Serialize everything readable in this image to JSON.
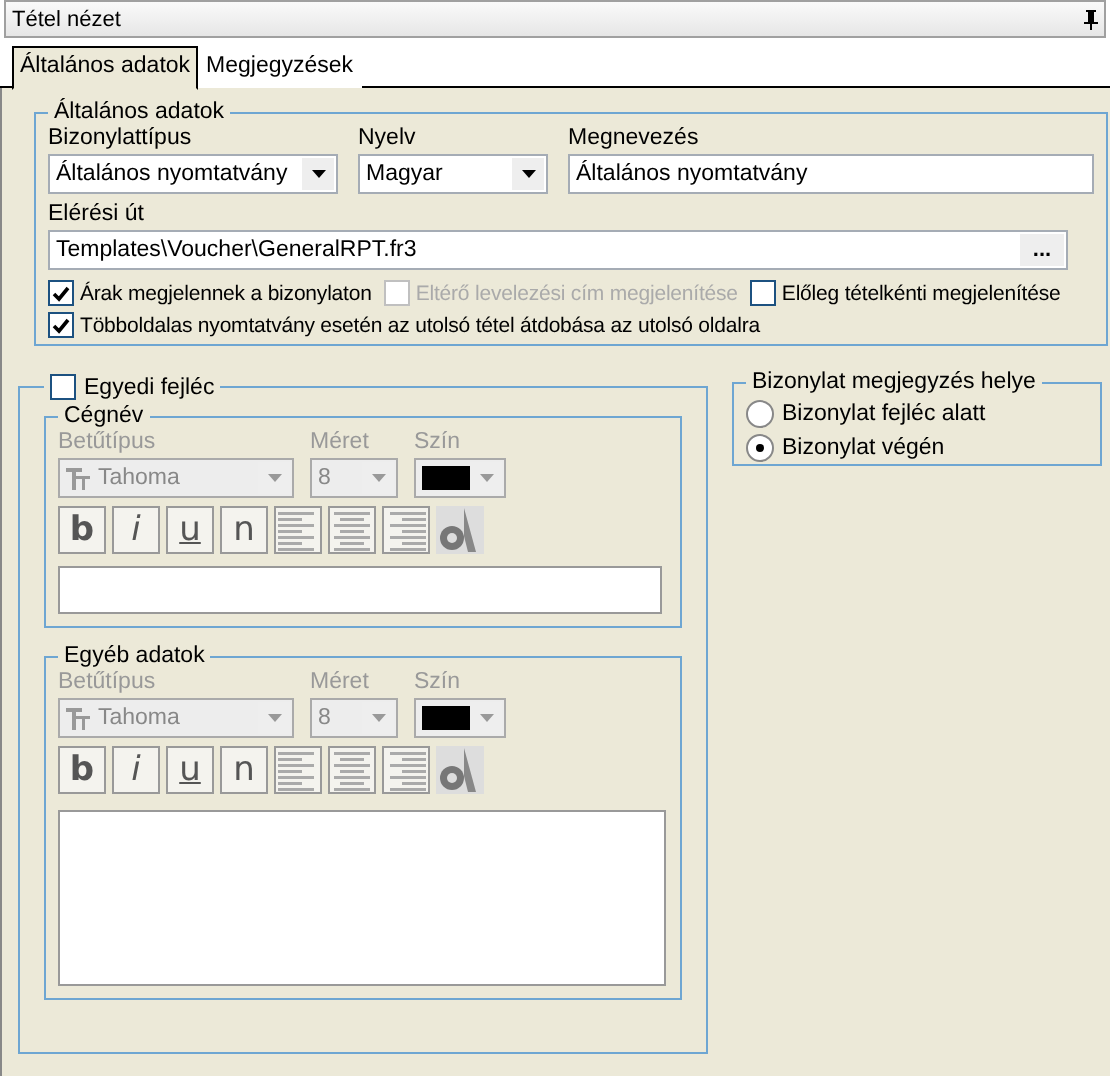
{
  "panel": {
    "title": "Tétel nézet"
  },
  "tabs": [
    {
      "label": "Általános adatok",
      "selected": true
    },
    {
      "label": "Megjegyzések",
      "selected": false
    }
  ],
  "general": {
    "legend": "Általános adatok",
    "fields": [
      {
        "kind": "select",
        "label": "Bizonylattípus",
        "value": "Általános nyomtatvány"
      },
      {
        "kind": "select",
        "label": "Nyelv",
        "value": "Magyar"
      },
      {
        "kind": "text",
        "label": "Megnevezés",
        "value": "Általános nyomtatvány"
      }
    ],
    "path": {
      "label": "Elérési út",
      "value": "Templates\\Voucher\\GeneralRPT.fr3",
      "button": "..."
    },
    "option_rows": [
      [
        {
          "label": "Árak megjelennek a bizonylaton",
          "checked": true,
          "disabled": false
        },
        {
          "label": "Eltérő levelezési cím megjelenítése",
          "checked": false,
          "disabled": true
        },
        {
          "label": "Előleg tételkénti megjelenítése",
          "checked": false,
          "disabled": false
        }
      ],
      [
        {
          "label": "Többoldalas nyomtatvány esetén az utolsó tétel átdobása az utolsó oldalra",
          "checked": true,
          "disabled": false
        }
      ]
    ]
  },
  "custom_header": {
    "label": "Egyedi fejléc",
    "checked": false,
    "sections": [
      {
        "legend": "Cégnév",
        "disabled": true,
        "font_label": "Betűtípus",
        "font_value": "Tahoma",
        "size_label": "Méret",
        "size_value": "8",
        "color_label": "Szín",
        "color": "#000000",
        "format_buttons": [
          "b",
          "i",
          "u",
          "n"
        ],
        "kind": "line"
      },
      {
        "legend": "Egyéb adatok",
        "disabled": true,
        "font_label": "Betűtípus",
        "font_value": "Tahoma",
        "size_label": "Méret",
        "size_value": "8",
        "color_label": "Szín",
        "color": "#000000",
        "format_buttons": [
          "b",
          "i",
          "u",
          "n"
        ],
        "kind": "memo"
      }
    ]
  },
  "note_position": {
    "legend": "Bizonylat megjegyzés helye",
    "options": [
      {
        "label": "Bizonylat fejléc alatt",
        "selected": false
      },
      {
        "label": "Bizonylat végén",
        "selected": true
      }
    ]
  }
}
